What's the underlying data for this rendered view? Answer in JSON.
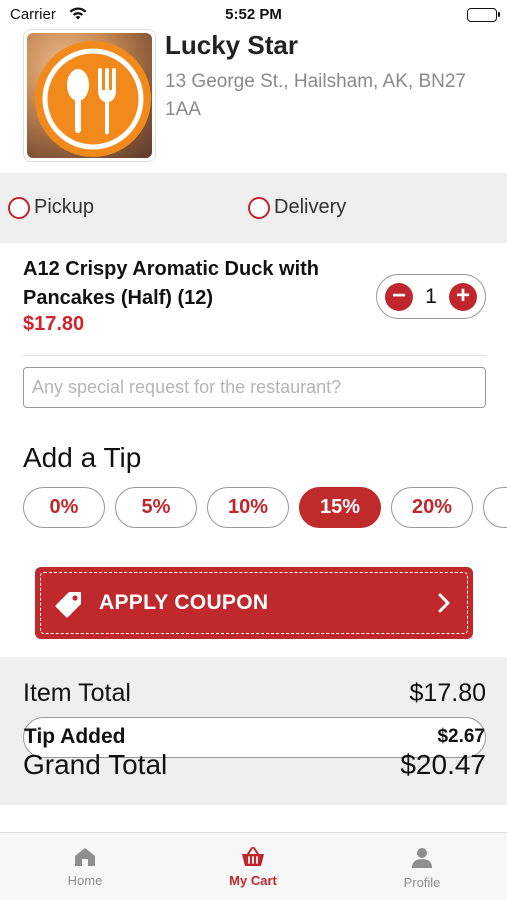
{
  "status_bar": {
    "carrier": "Carrier",
    "time": "5:52 PM"
  },
  "restaurant": {
    "name": "Lucky Star",
    "address": "13 George St., Hailsham, AK, BN27 1AA"
  },
  "order_type": {
    "options": [
      "Pickup",
      "Delivery"
    ],
    "selected": null
  },
  "cart_item": {
    "name": "A12 Crispy Aromatic Duck with Pancakes (Half) (12)",
    "price": "$17.80",
    "quantity": "1",
    "decrement_symbol": "−",
    "increment_symbol": "+"
  },
  "special_request": {
    "value": "",
    "placeholder": "Any special request for the restaurant?"
  },
  "tips": {
    "title": "Add a Tip",
    "options": [
      "0%",
      "5%",
      "10%",
      "15%",
      "20%"
    ],
    "selected": "15%"
  },
  "coupon": {
    "label": "APPLY COUPON"
  },
  "totals": {
    "item_total_label": "Item Total",
    "item_total_value": "$17.80",
    "tip_label": "Tip Added",
    "tip_value": "$2.67",
    "grand_total_label": "Grand Total",
    "grand_total_value": "$20.47"
  },
  "tab_bar": {
    "home": "Home",
    "cart": "My Cart",
    "profile": "Profile",
    "active": "cart"
  },
  "colors": {
    "accent": "#c0272d",
    "logo_orange": "#f28a1b",
    "panel_gray": "#efefef"
  },
  "icons": {
    "logo": "spoon-fork-icon",
    "coupon": "tag-icon",
    "coupon_arrow": "chevron-right-icon",
    "home": "home-icon",
    "cart": "basket-icon",
    "profile": "person-icon"
  }
}
